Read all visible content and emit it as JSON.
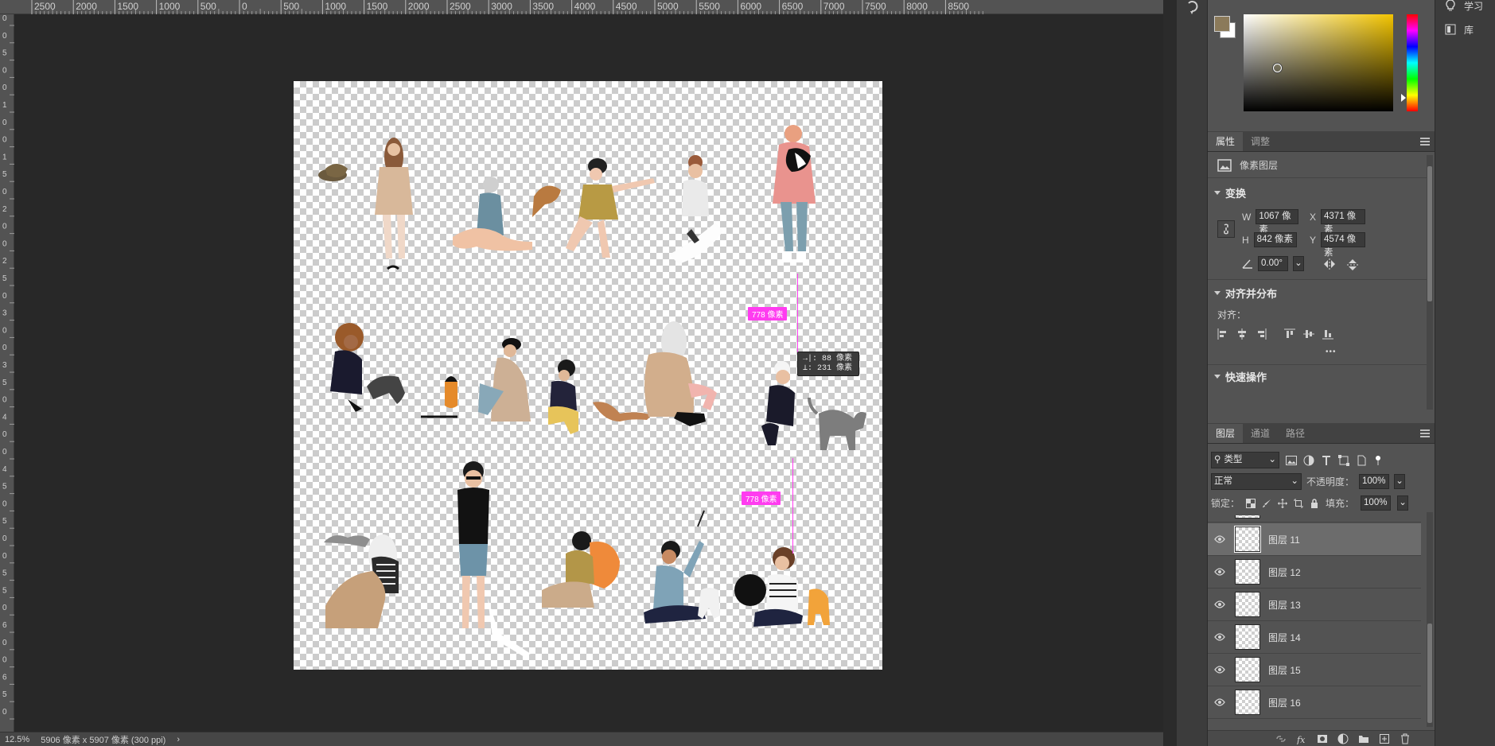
{
  "ruler": {
    "top_labels": [
      "2500",
      "2000",
      "1500",
      "1000",
      "500",
      "0",
      "500",
      "1000",
      "1500",
      "2000",
      "2500",
      "3000",
      "3500",
      "4000",
      "4500",
      "5000",
      "5500",
      "6000",
      "6500",
      "7000",
      "7500",
      "8000",
      "8500"
    ],
    "left_labels": [
      "0",
      "0",
      "5",
      "0",
      "0",
      "1",
      "0",
      "0",
      "1",
      "5",
      "0",
      "2",
      "0",
      "0",
      "2",
      "5",
      "0",
      "3",
      "0",
      "0",
      "3",
      "5",
      "0",
      "4",
      "0",
      "0",
      "4",
      "5",
      "0",
      "5",
      "0",
      "0",
      "5",
      "5",
      "0",
      "6",
      "0",
      "0",
      "6",
      "5",
      "0"
    ]
  },
  "canvas": {
    "guides": {
      "top_distance": "778 像素",
      "bottom_distance": "778 像素"
    },
    "tooltip": {
      "line1": "→|:   88 像素",
      "line2": "⊥:  231 像素"
    }
  },
  "status": {
    "zoom": "12.5%",
    "doc_info": "5906 像素 x 5907 像素 (300 ppi)",
    "arrow": "›"
  },
  "far_strip": {
    "items": [
      {
        "icon": "lightbulb-icon",
        "label": "学习"
      },
      {
        "icon": "library-icon",
        "label": "库"
      }
    ]
  },
  "color": {
    "foreground": "#8b7a5a",
    "background": "#ffffff",
    "field_hue": "#f2c400"
  },
  "properties": {
    "tabs": [
      "属性",
      "调整"
    ],
    "layer_type": "像素图层",
    "transform": {
      "title": "变换",
      "w_label": "W",
      "w_value": "1067 像素",
      "x_label": "X",
      "x_value": "4371 像素",
      "h_label": "H",
      "h_value": "842 像素",
      "y_label": "Y",
      "y_value": "4574 像素",
      "angle": "0.00°"
    },
    "align": {
      "title": "对齐并分布",
      "subtitle": "对齐：",
      "more": "•••"
    },
    "quick": {
      "title": "快速操作"
    }
  },
  "layers": {
    "tabs": [
      "图层",
      "通道",
      "路径"
    ],
    "filter_kind": "类型",
    "blend_mode": "正常",
    "opacity_label": "不透明度：",
    "opacity_value": "100%",
    "lock_label": "锁定：",
    "fill_label": "填充：",
    "fill_value": "100%",
    "rows": [
      {
        "name": "图层 11",
        "selected": true
      },
      {
        "name": "图层 12",
        "selected": false
      },
      {
        "name": "图层 13",
        "selected": false
      },
      {
        "name": "图层 14",
        "selected": false
      },
      {
        "name": "图层 15",
        "selected": false
      },
      {
        "name": "图层 16",
        "selected": false
      }
    ]
  }
}
